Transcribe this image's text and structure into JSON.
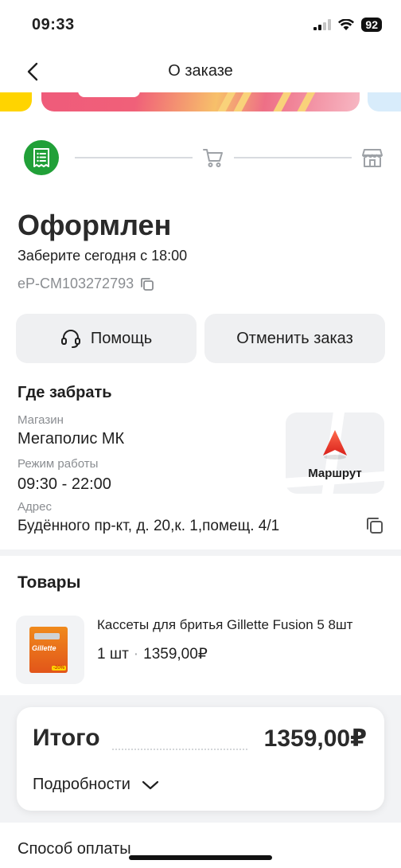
{
  "status_bar": {
    "time": "09:33",
    "battery": "92",
    "icons": [
      "signal-icon",
      "wifi-icon",
      "battery-icon"
    ]
  },
  "nav": {
    "title": "О заказе",
    "back_icon": "chevron-left-icon"
  },
  "progress": {
    "steps": [
      {
        "icon": "receipt-icon",
        "state": "done"
      },
      {
        "icon": "cart-icon",
        "state": "pending"
      },
      {
        "icon": "store-icon",
        "state": "pending"
      }
    ],
    "accent_color": "#21a038"
  },
  "order": {
    "status": "Оформлен",
    "pickup_time": "Заберите сегодня с 18:00",
    "id": "eP-CM103272793"
  },
  "actions": {
    "help_label": "Помощь",
    "cancel_label": "Отменить заказ"
  },
  "pickup": {
    "section_title": "Где забрать",
    "store_label": "Магазин",
    "store_value": "Мегаполис МК",
    "hours_label": "Режим работы",
    "hours_value": "09:30 - 22:00",
    "address_label": "Адрес",
    "address_value": "Будённого пр-кт, д. 20,к. 1,помещ. 4/1",
    "route_label": "Маршрут"
  },
  "products": {
    "section_title": "Товары",
    "items": [
      {
        "name": "Кассеты для бритья Gillette Fusion 5 8шт",
        "quantity": "1 шт",
        "price": "1359,00₽"
      }
    ]
  },
  "summary": {
    "total_label": "Итого",
    "total_amount": "1359,00₽",
    "details_label": "Подробности"
  },
  "payment": {
    "section_title": "Способ оплаты"
  }
}
